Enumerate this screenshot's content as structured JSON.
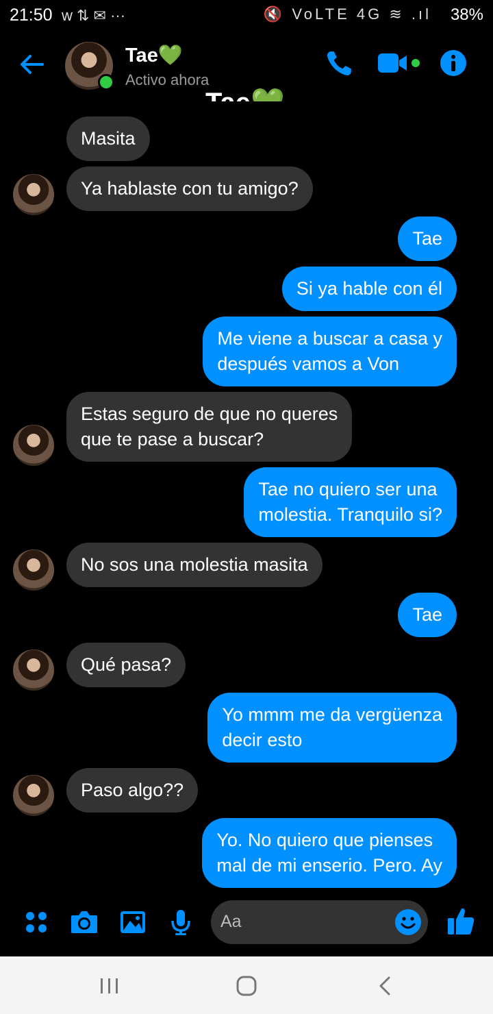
{
  "status_bar": {
    "time": "21:50",
    "notifications": "w ⇅ ✉ ···",
    "system_icons": "🔇 VoLTE 4G ≋ .ıl",
    "battery": "38%"
  },
  "header": {
    "contact_name": "Tae💚",
    "status_text": "Activo ahora"
  },
  "hidden_title": "Tae💚",
  "messages": [
    {
      "from": "them",
      "text": "Masita"
    },
    {
      "from": "them",
      "text": "Ya hablaste con tu amigo?"
    },
    {
      "from": "me",
      "text": "Tae"
    },
    {
      "from": "me",
      "text": "Si ya hable con él"
    },
    {
      "from": "me",
      "lines": [
        "Me viene a buscar a casa y",
        "después vamos a Von"
      ]
    },
    {
      "from": "them",
      "lines": [
        "Estas seguro de que no queres",
        "que te pase a buscar?"
      ]
    },
    {
      "from": "me",
      "lines": [
        "Tae no quiero ser una",
        "molestia. Tranquilo si?"
      ]
    },
    {
      "from": "them",
      "text": "No sos una molestia masita"
    },
    {
      "from": "me",
      "text": "Tae"
    },
    {
      "from": "them",
      "text": "Qué pasa?"
    },
    {
      "from": "me",
      "lines": [
        "Yo mmm me da vergüenza",
        "decir esto"
      ]
    },
    {
      "from": "them",
      "text": "Paso algo??"
    },
    {
      "from": "me",
      "lines": [
        "Yo. No quiero que pienses",
        "mal de mi enserio. Pero. Ay"
      ]
    }
  ],
  "composer": {
    "placeholder": "Aa"
  },
  "colors": {
    "accent": "#0090ff",
    "incoming_bubble": "#333333",
    "online": "#31cc46"
  }
}
